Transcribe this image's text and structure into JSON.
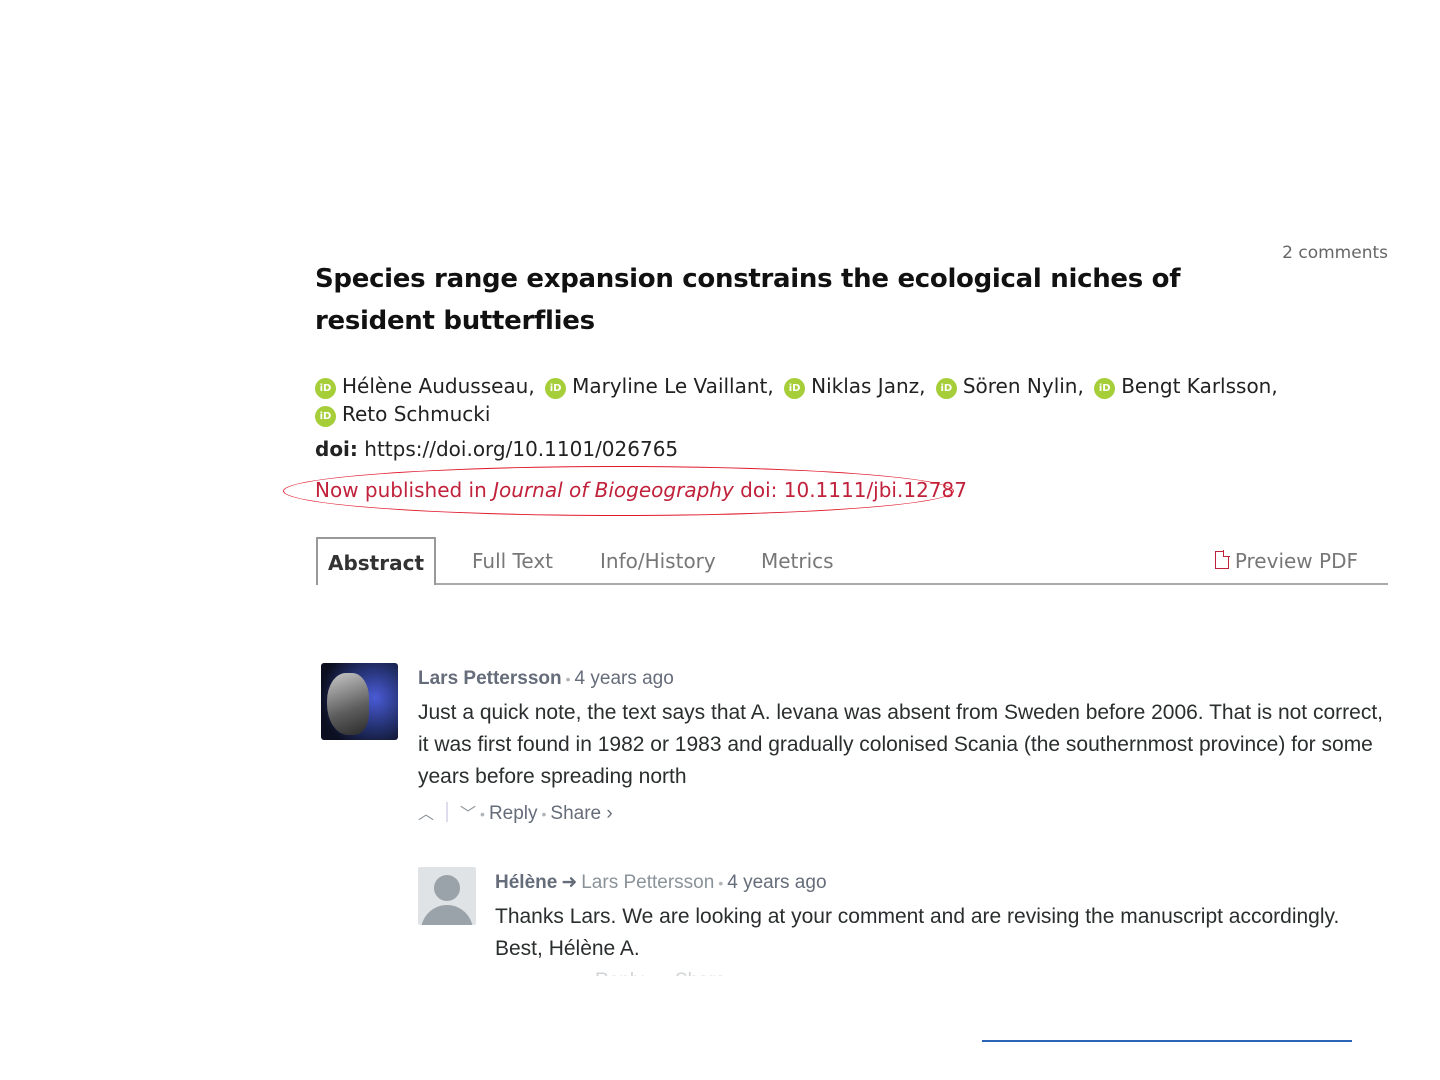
{
  "header": {
    "comments_count": "2 comments",
    "title": "Species range expansion constrains the ecological niches of resident butterflies"
  },
  "authors": [
    {
      "name": "Hélène Audusseau,"
    },
    {
      "name": "Maryline Le Vaillant,"
    },
    {
      "name": "Niklas Janz,"
    },
    {
      "name": "Sören Nylin,"
    },
    {
      "name": "Bengt Karlsson,"
    },
    {
      "name": "Reto Schmucki"
    }
  ],
  "orcid_label": "iD",
  "doi": {
    "label": "doi:",
    "value": "https://doi.org/10.1101/026765"
  },
  "published": {
    "prefix": "Now published in",
    "journal": "Journal of Biogeography",
    "doi": "doi: 10.1111/jbi.12787",
    "highlight_color": "#e0182a"
  },
  "tabs": [
    {
      "label": "Abstract",
      "active": true
    },
    {
      "label": "Full Text"
    },
    {
      "label": "Info/History"
    },
    {
      "label": "Metrics"
    }
  ],
  "preview_pdf": "Preview PDF",
  "comments": [
    {
      "author": "Lars Pettersson",
      "time": "4 years ago",
      "text": "Just a quick note, the text says that A. levana was absent from Sweden before 2006. That is not correct, it was first found in 1982 or 1983 and gradually colonised Scania (the southernmost province) for some years before spreading north",
      "actions": {
        "reply": "Reply",
        "share": "Share ›"
      }
    },
    {
      "author": "Hélène",
      "reply_to": "Lars Pettersson",
      "time": "4 years ago",
      "text": "Thanks Lars. We are looking at your comment and are revising the manuscript accordingly. Best, Hélène A.",
      "actions": {
        "reply": "Reply",
        "share": "Share ›"
      }
    }
  ],
  "colors": {
    "accent_red": "#c0213b",
    "orcid_green": "#a6ce39",
    "link_blue": "#2a66b5"
  }
}
